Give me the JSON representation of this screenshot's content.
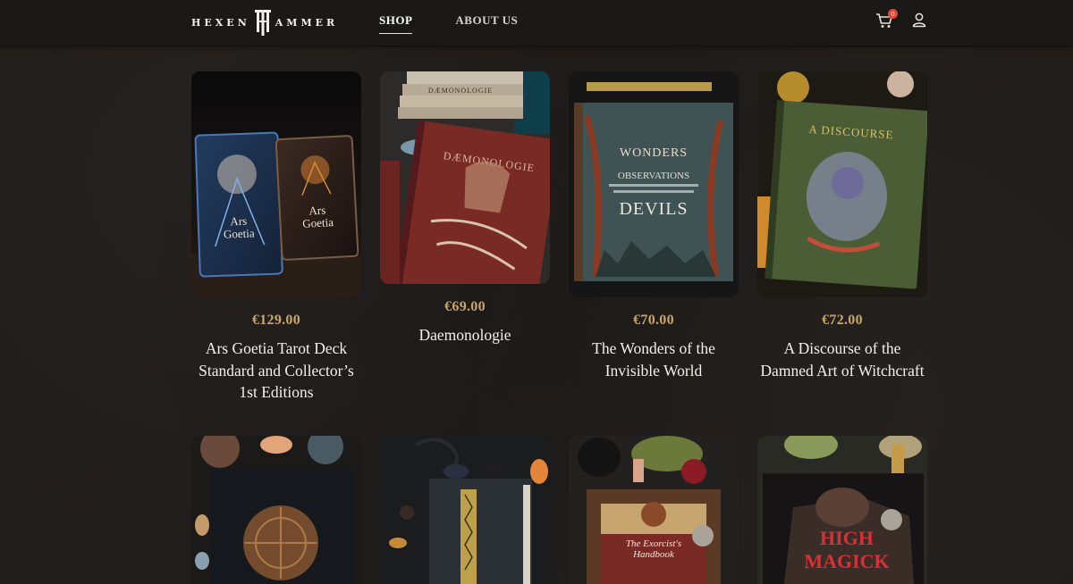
{
  "header": {
    "logo_text_left": "HEXEN",
    "logo_text_right": "AMMER",
    "nav": [
      {
        "label": "SHOP",
        "active": true
      },
      {
        "label": "ABOUT US",
        "active": false
      }
    ],
    "cart_count": "0",
    "icons": {
      "cart": "cart-icon",
      "user": "user-icon"
    },
    "colors": {
      "badge": "#e2463a",
      "price": "#c9a66b"
    }
  },
  "products": [
    {
      "price": "€129.00",
      "title": "Ars Goetia Tarot Deck Standard and Collector’s 1st Editions"
    },
    {
      "price": "€69.00",
      "title": "Daemonologie"
    },
    {
      "price": "€70.00",
      "title": "The Wonders of the Invisible World"
    },
    {
      "price": "€72.00",
      "title": "A Discourse of the Damned Art of Witchcraft"
    }
  ],
  "images": {
    "p0_card1": "Ars",
    "p0_card1b": "Goetia",
    "p0_card2": "Ars",
    "p0_card2b": "Goetia",
    "p1_spine": "DÆMONOLOGIE",
    "p1_cover": "DÆMONOLOGIE",
    "p2_line1": "WONDERS",
    "p2_line2": "OBSERVATIONS",
    "p2_line3": "DEVILS",
    "p3_line1": "A DISCOURSE",
    "p6_line1": "The Exorcist's",
    "p6_line2": "Handbook",
    "p7_line1": "HIGH",
    "p7_line2": "MAGICK"
  }
}
